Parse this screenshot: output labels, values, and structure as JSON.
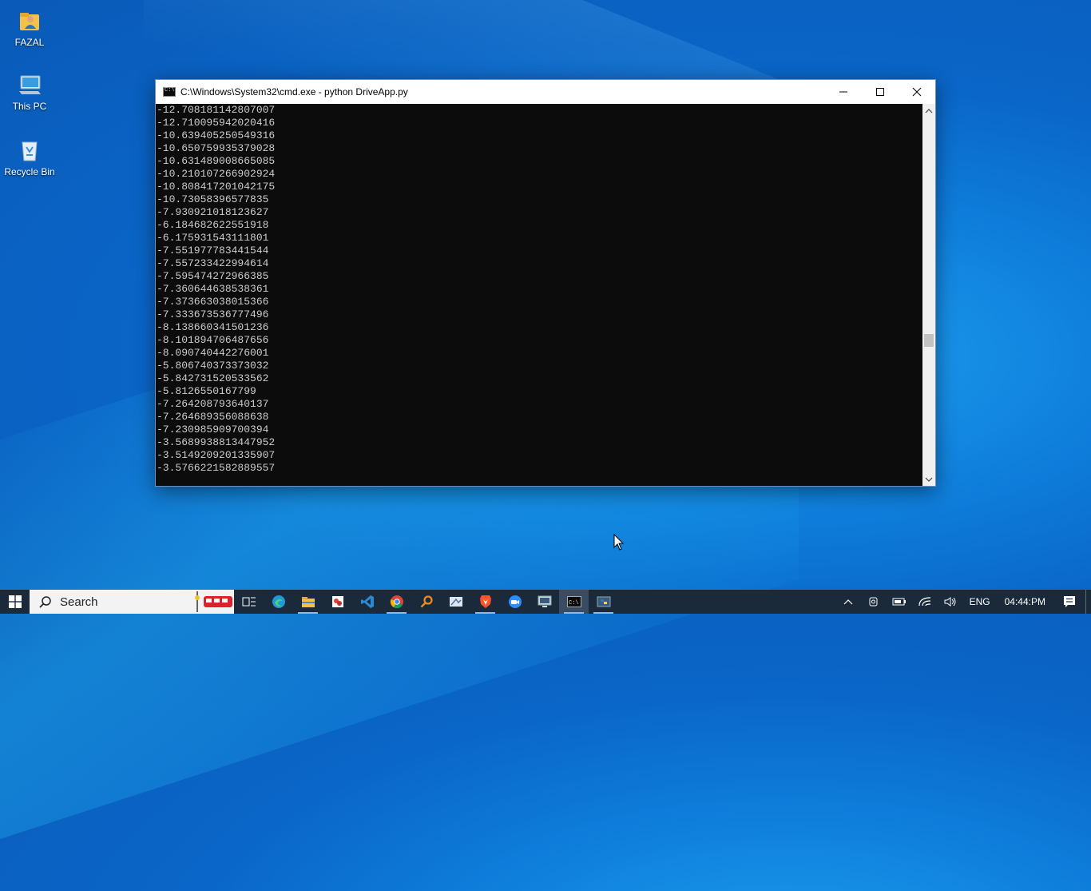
{
  "desktop": {
    "icons": [
      {
        "label": "FAZAL",
        "icon": "user-folder-icon"
      },
      {
        "label": "This PC",
        "icon": "computer-icon"
      },
      {
        "label": "Recycle Bin",
        "icon": "recycle-bin-icon"
      }
    ]
  },
  "window": {
    "title": "C:\\Windows\\System32\\cmd.exe - python  DriveApp.py",
    "app_icon": "cmd-icon",
    "controls": {
      "minimize": "minimize-icon",
      "maximize": "maximize-icon",
      "close": "close-icon"
    },
    "console_lines": [
      "-12.708181142807007",
      "-12.710095942020416",
      "-10.639405250549316",
      "-10.650759935379028",
      "-10.631489008665085",
      "-10.210107266902924",
      "-10.808417201042175",
      "-10.73058396577835",
      "-7.930921018123627",
      "-6.184682622551918",
      "-6.175931543111801",
      "-7.551977783441544",
      "-7.557233422994614",
      "-7.595474272966385",
      "-7.360644638538361",
      "-7.373663038015366",
      "-7.333673536777496",
      "-8.138660341501236",
      "-8.101894706487656",
      "-8.090740442276001",
      "-5.806740373373032",
      "-5.842731520533562",
      "-5.8126550167799",
      "-7.264208793640137",
      "-7.264689356088638",
      "-7.230985909700394",
      "-3.5689938813447952",
      "-3.5149209201335907",
      "-3.5766221582889557"
    ]
  },
  "taskbar": {
    "search_placeholder": "Search",
    "apps": [
      {
        "name": "task-view-icon"
      },
      {
        "name": "edge-icon"
      },
      {
        "name": "file-explorer-icon"
      },
      {
        "name": "app-red-icon"
      },
      {
        "name": "vscode-icon"
      },
      {
        "name": "chrome-icon"
      },
      {
        "name": "search-tool-icon"
      },
      {
        "name": "snipping-icon"
      },
      {
        "name": "brave-icon"
      },
      {
        "name": "zoom-icon"
      },
      {
        "name": "monitor-app-icon"
      },
      {
        "name": "cmd-icon"
      },
      {
        "name": "python-icon"
      }
    ],
    "tray": {
      "language": "ENG",
      "time": "04:44:PM"
    }
  }
}
